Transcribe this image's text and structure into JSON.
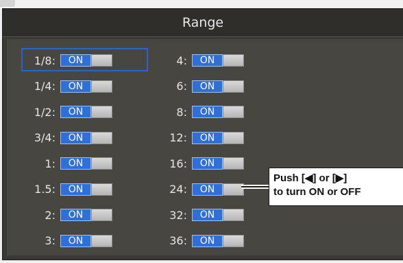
{
  "panel": {
    "title": "Range"
  },
  "left_column": [
    {
      "label": "1/8:",
      "state": "ON",
      "selected": true
    },
    {
      "label": "1/4:",
      "state": "ON"
    },
    {
      "label": "1/2:",
      "state": "ON"
    },
    {
      "label": "3/4:",
      "state": "ON"
    },
    {
      "label": "1:",
      "state": "ON"
    },
    {
      "label": "1.5:",
      "state": "ON"
    },
    {
      "label": "2:",
      "state": "ON"
    },
    {
      "label": "3:",
      "state": "ON"
    }
  ],
  "right_column": [
    {
      "label": "4:",
      "state": "ON"
    },
    {
      "label": "6:",
      "state": "ON"
    },
    {
      "label": "8:",
      "state": "ON"
    },
    {
      "label": "12:",
      "state": "ON"
    },
    {
      "label": "16:",
      "state": "ON"
    },
    {
      "label": "24:",
      "state": "ON"
    },
    {
      "label": "32:",
      "state": "ON"
    },
    {
      "label": "36:",
      "state": "ON"
    }
  ],
  "callout": {
    "line1": "Push [◀] or [▶]",
    "line2": "to turn ON or OFF"
  },
  "colors": {
    "switch_on": "#2f6fd8",
    "selection": "#2d63c8",
    "panel_bg": "#484640"
  }
}
